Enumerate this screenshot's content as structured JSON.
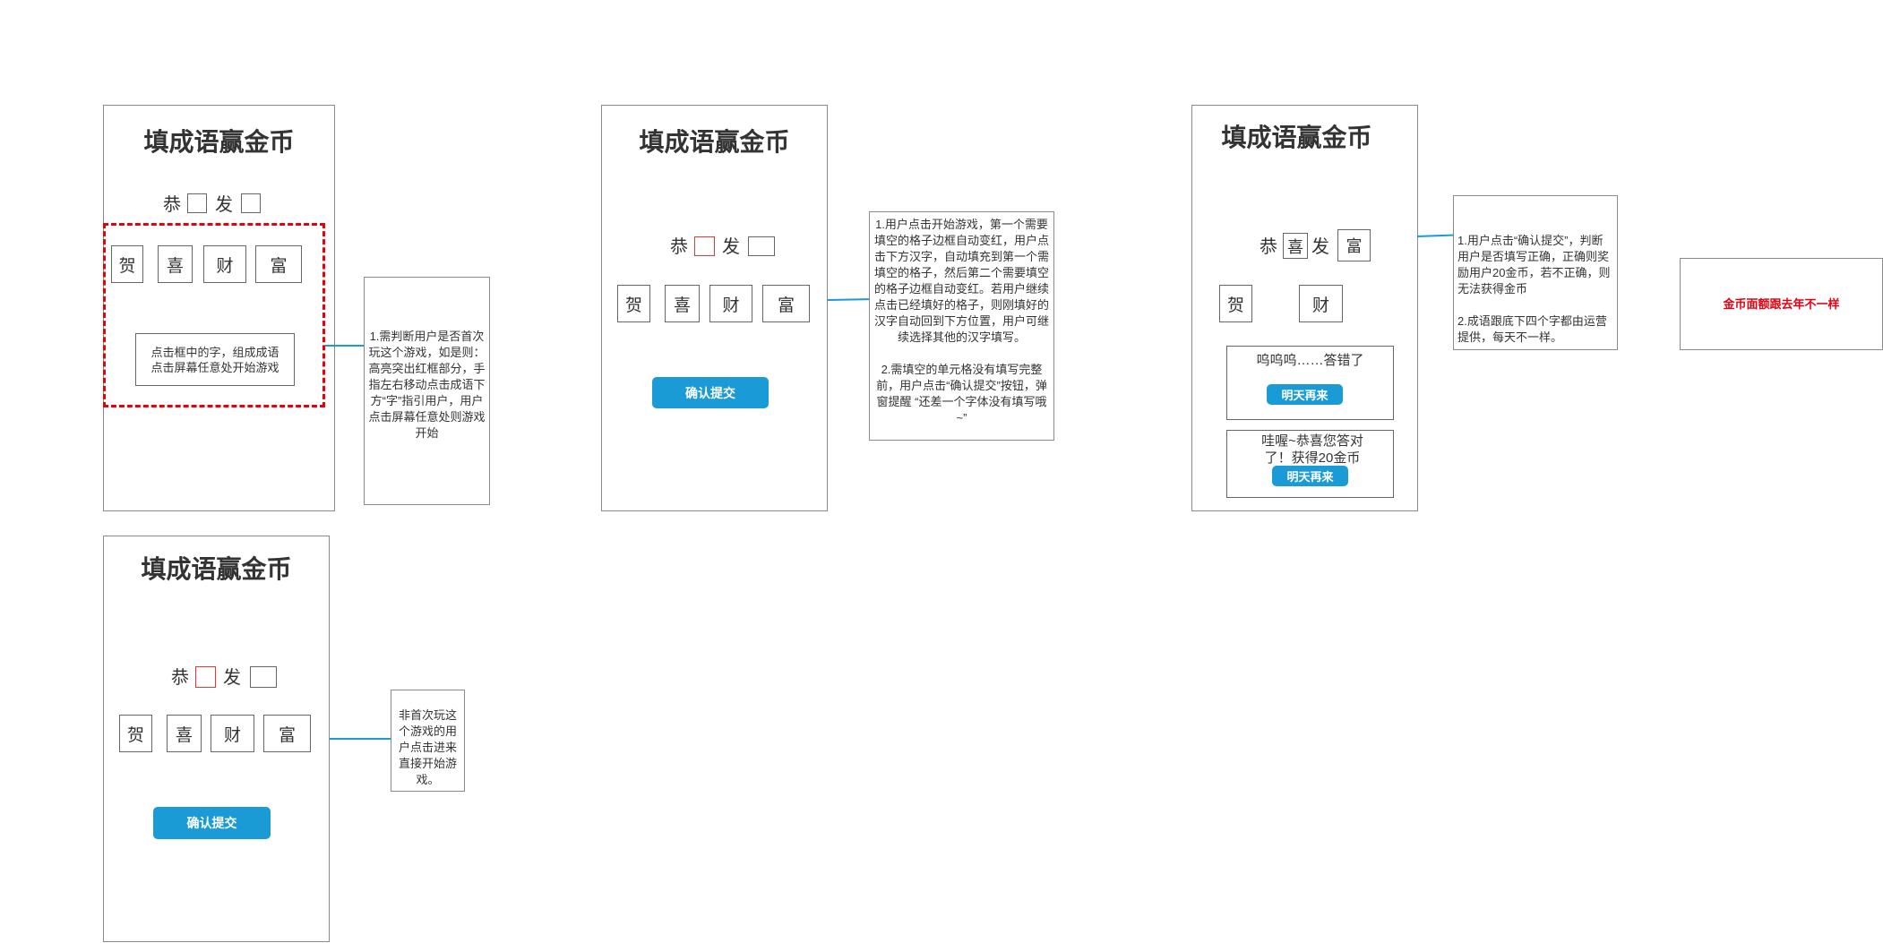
{
  "screens": [
    {
      "title": "填成语赢金币",
      "char1": "恭",
      "char2": "发",
      "tiles": [
        "贺",
        "喜",
        "财",
        "富"
      ],
      "hint": "点击框中的字，组成成语点击屏幕任意处开始游戏"
    },
    {
      "title": "填成语赢金币",
      "char1": "恭",
      "char2": "发",
      "tiles": [
        "贺",
        "喜",
        "财",
        "富"
      ],
      "button": "确认提交"
    },
    {
      "title": "填成语赢金币",
      "char1": "恭",
      "filled1": "喜",
      "char2": "发",
      "filled2": "富",
      "tiles": [
        "贺",
        "财"
      ],
      "wrong_text": "呜呜呜……答错了",
      "wrong_button": "明天再来",
      "right_text": "哇喔~恭喜您答对了！获得20金币",
      "right_button": "明天再来"
    },
    {
      "title": "填成语赢金币",
      "char1": "恭",
      "char2": "发",
      "tiles": [
        "贺",
        "喜",
        "财",
        "富"
      ],
      "button": "确认提交"
    }
  ],
  "notes": {
    "first_play": "1.需判断用户是否首次玩这个游戏，如是则：高亮突出红框部分，手指左右移动点击成语下方“字”指引用户，用户点击屏幕任意处则游戏开始",
    "fill": [
      "1.用户点击开始游戏，第一个需要填空的格子边框自动变红，用户点击下方汉字，自动填充到第一个需填空的格子，然后第二个需要填空的格子边框自动变红。若用户继续点击已经填好的格子，则刚填好的汉字自动回到下方位置，用户可继续选择其他的汉字填写。",
      "2.需填空的单元格没有填写完整前，用户点击“确认提交”按钮，弹窗提醒 “还差一个字体没有填写哦~”"
    ],
    "submit": [
      "1.用户点击“确认提交”，判断用户是否填写正确，正确则奖励用户20金币，若不正确，则无法获得金币",
      "2.成语跟底下四个字都由运营提供，每天不一样。"
    ],
    "repeat_play": "非首次玩这个游戏的用户点击进来直接开始游戏。",
    "coin": "金币面额跟去年不一样"
  },
  "colors": {
    "accent": "#1a9bd6",
    "highlight_red": "#e8000b",
    "coin_note_red": "#e60012"
  }
}
